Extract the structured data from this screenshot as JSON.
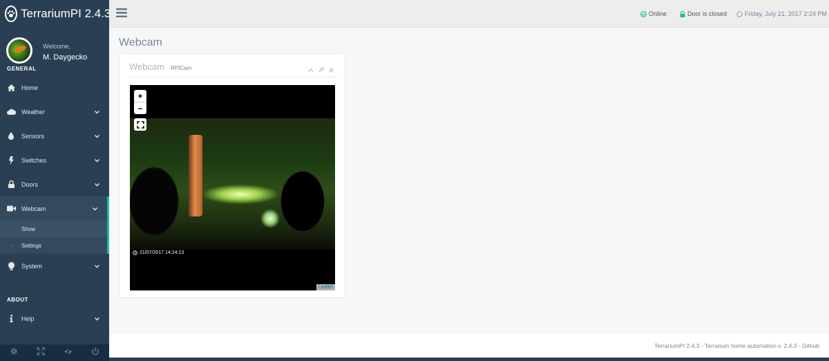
{
  "app": {
    "title": "TerrariumPI 2.4.3"
  },
  "profile": {
    "welcome": "Welcome,",
    "name": "M. Daygecko"
  },
  "sidebar": {
    "general_label": "GENERAL",
    "about_label": "ABOUT",
    "items": [
      {
        "label": "Home",
        "icon": "home-icon"
      },
      {
        "label": "Weather",
        "icon": "cloud-icon"
      },
      {
        "label": "Sensors",
        "icon": "tint-icon"
      },
      {
        "label": "Switches",
        "icon": "bolt-icon"
      },
      {
        "label": "Doors",
        "icon": "lock-icon"
      },
      {
        "label": "Webcam",
        "icon": "video-camera-icon"
      },
      {
        "label": "System",
        "icon": "lightbulb-icon"
      }
    ],
    "webcam_sub": [
      {
        "label": "Show"
      },
      {
        "label": "Settings"
      }
    ],
    "about_items": [
      {
        "label": "Help",
        "icon": "info-icon"
      }
    ],
    "footer_icons": [
      "settings-icon",
      "fullscreen-icon",
      "eye-slash-icon",
      "power-off-icon"
    ]
  },
  "topnav": {
    "online": "Online",
    "door": "Door is closed",
    "datetime": "Friday, July 21, 2017 2:24 PM"
  },
  "page": {
    "title": "Webcam"
  },
  "panel": {
    "title": "Webcam",
    "subtitle": "RPICam",
    "zoom_in": "+",
    "zoom_out": "−",
    "timestamp": "21/07/2017 14:24:13",
    "attribution": "Leaflet"
  },
  "footer": {
    "text": "TerrariumPI 2.4.3 - Terrarium home automation v. 2.4.3 - Github"
  },
  "colors": {
    "sidebar": "#2a3f54",
    "accent": "#1abb9c",
    "text_muted": "#73879c"
  }
}
